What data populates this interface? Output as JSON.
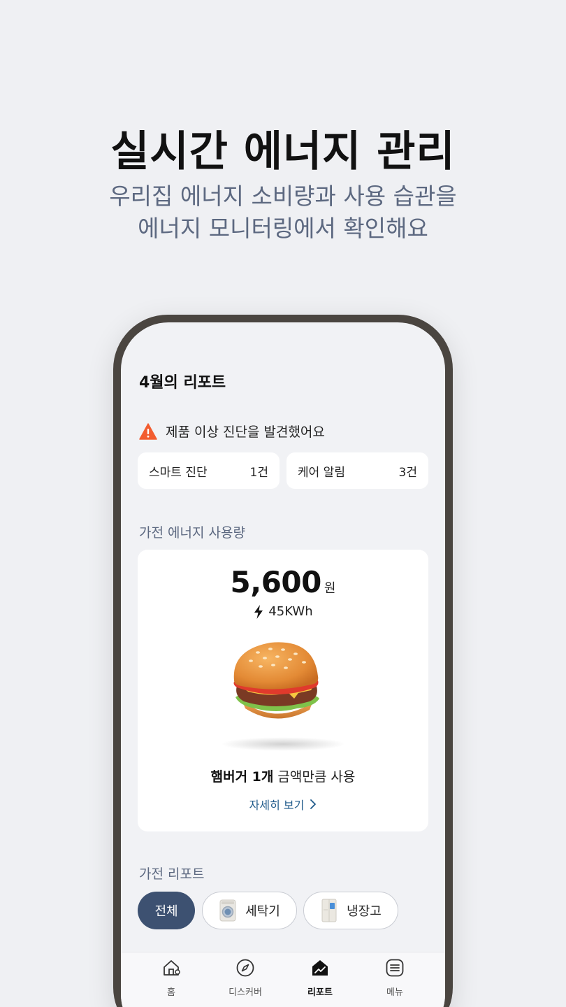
{
  "hero": {
    "title": "실시간 에너지 관리",
    "subtitle_line1": "우리집 에너지 소비량과 사용 습관을",
    "subtitle_line2": "에너지 모니터링에서 확인해요"
  },
  "report": {
    "title": "4월의 리포트",
    "alert": {
      "icon": "warning-icon",
      "text": "제품 이상 진단을 발견했어요",
      "color": "#f25c2f"
    },
    "stats": [
      {
        "label": "스마트 진단",
        "value": "1건"
      },
      {
        "label": "케어 알림",
        "value": "3건"
      }
    ]
  },
  "energy": {
    "section_title": "가전 에너지 사용량",
    "amount": "5,600",
    "unit": "원",
    "kwh": "45KWh",
    "comparison_bold": "햄버거 1개",
    "comparison_rest": " 금액만큼 사용",
    "detail_link": "자세히 보기",
    "illustration": "hamburger"
  },
  "appliances": {
    "section_title": "가전 리포트",
    "chips": [
      {
        "label": "전체",
        "selected": true
      },
      {
        "label": "세탁기",
        "icon": "washer-icon",
        "selected": false
      },
      {
        "label": "냉장고",
        "icon": "fridge-icon",
        "selected": false
      }
    ],
    "accent": "#3d5171"
  },
  "nav": {
    "items": [
      {
        "label": "홈",
        "icon": "home-icon",
        "active": false
      },
      {
        "label": "디스커버",
        "icon": "compass-icon",
        "active": false
      },
      {
        "label": "리포트",
        "icon": "report-icon",
        "active": true
      },
      {
        "label": "메뉴",
        "icon": "menu-icon",
        "active": false
      }
    ]
  }
}
